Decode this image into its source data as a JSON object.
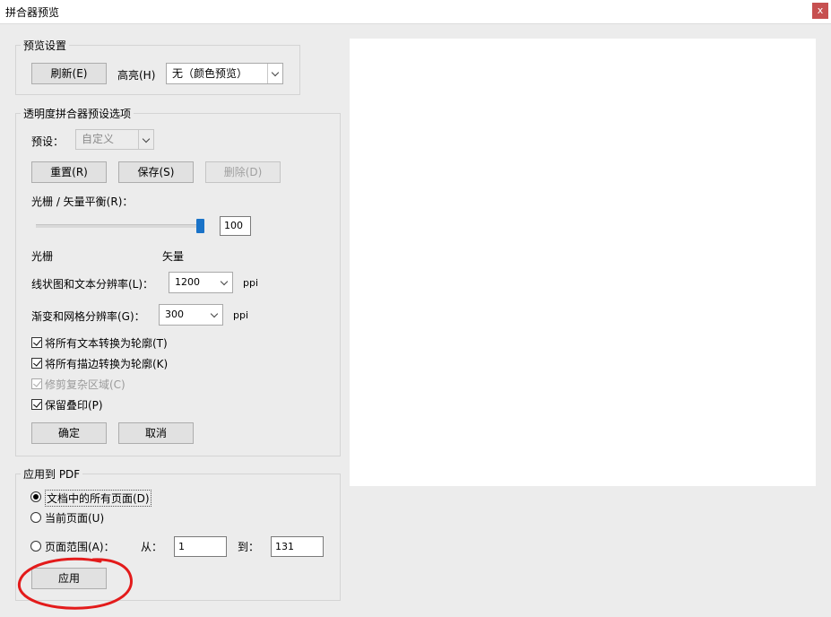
{
  "window": {
    "title": "拼合器预览",
    "close_label": "x"
  },
  "preview_settings": {
    "group_label": "预览设置",
    "refresh_button": "刷新(E)",
    "highlight_label": "高亮(H)",
    "highlight_value": "无（颜色预览）"
  },
  "preset_options": {
    "group_label": "透明度拼合器预设选项",
    "preset_label": "预设：",
    "preset_value": "自定义",
    "reset_button": "重置(R)",
    "save_button": "保存(S)",
    "delete_button": "删除(D)",
    "balance_label": "光栅 / 矢量平衡(R)：",
    "balance_value": "100",
    "balance_level_percent": 100,
    "raster_label": "光栅",
    "vector_label": "矢量",
    "line_art_label": "线状图和文本分辨率(L)：",
    "line_art_value": "1200",
    "line_art_unit": "ppi",
    "gradient_label": "渐变和网格分辨率(G)：",
    "gradient_value": "300",
    "gradient_unit": "ppi",
    "checkboxes": [
      {
        "label": "将所有文本转换为轮廓(T)",
        "checked": true,
        "disabled": false
      },
      {
        "label": "将所有描边转换为轮廓(K)",
        "checked": true,
        "disabled": false
      },
      {
        "label": "修剪复杂区域(C)",
        "checked": true,
        "disabled": true
      },
      {
        "label": "保留叠印(P)",
        "checked": true,
        "disabled": false
      }
    ],
    "ok_button": "确定",
    "cancel_button": "取消"
  },
  "apply_pdf": {
    "group_label": "应用到 PDF",
    "options": [
      {
        "label": "文档中的所有页面(D)",
        "selected": true
      },
      {
        "label": "当前页面(U)",
        "selected": false
      },
      {
        "label": "页面范围(A)：",
        "selected": false
      }
    ],
    "from_label": "从：",
    "from_value": "1",
    "to_label": "到：",
    "to_value": "131",
    "apply_button": "应用"
  },
  "colors": {
    "highlight_circle": "#e31b1b",
    "slider_thumb": "#1a73c8",
    "close_button": "#c75050"
  }
}
